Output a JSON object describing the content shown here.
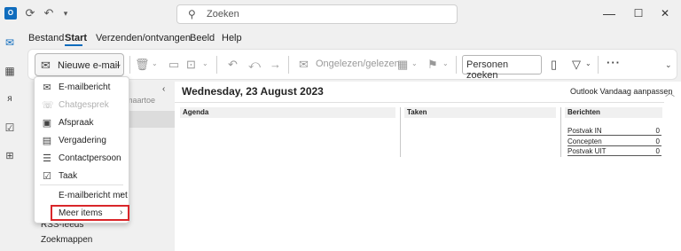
{
  "titlebar": {
    "app_icon_text": "O",
    "quick_access": [
      "refresh-icon",
      "undo-icon",
      "customize-icon"
    ],
    "search_placeholder": "Zoeken",
    "window_controls": {
      "minimize": "—",
      "maximize": "☐",
      "close": "✕"
    }
  },
  "menu": {
    "items": [
      "Bestand",
      "Start",
      "Verzenden/ontvangen",
      "Beeld",
      "Help"
    ],
    "active": "Start"
  },
  "ribbon": {
    "new_mail_label": "Nieuwe e-mail",
    "read_unread_label": "Ongelezen/gelezen",
    "people_search_label": "Personen zoeken",
    "more_label": "···"
  },
  "dropdown": {
    "items": [
      {
        "label": "E-mailbericht",
        "icon": "mail-icon",
        "disabled": false
      },
      {
        "label": "Chatgesprek",
        "icon": "chat-icon",
        "disabled": true
      },
      {
        "label": "Afspraak",
        "icon": "appointment-icon",
        "disabled": false
      },
      {
        "label": "Vergadering",
        "icon": "meeting-icon",
        "disabled": false
      },
      {
        "label": "Contactpersoon",
        "icon": "contact-icon",
        "disabled": false
      },
      {
        "label": "Taak",
        "icon": "task-icon",
        "disabled": false
      },
      {
        "label": "E-mailbericht met",
        "icon": "",
        "disabled": false,
        "submenu": true
      },
      {
        "label": "Meer items",
        "icon": "",
        "disabled": false,
        "submenu": true
      }
    ],
    "highlight_color": "#d9262a"
  },
  "folder_pane": {
    "collapse_icon": "‹",
    "partial_label": "maartoe",
    "items": [
      "RSS-feeds",
      "Zoekmappen"
    ]
  },
  "today": {
    "date_header": "Wednesday, 23 August 2023",
    "customize_label": "Outlook Vandaag aanpassen ...",
    "columns": [
      "Agenda",
      "Taken",
      "Berichten"
    ],
    "messages": [
      {
        "label": "Postvak IN",
        "count": "0"
      },
      {
        "label": "Concepten",
        "count": "0"
      },
      {
        "label": "Postvak UIT",
        "count": "0"
      }
    ]
  },
  "colors": {
    "accent": "#0f6cbd",
    "background": "#f0f0f0",
    "content_bg": "#ffffff"
  }
}
